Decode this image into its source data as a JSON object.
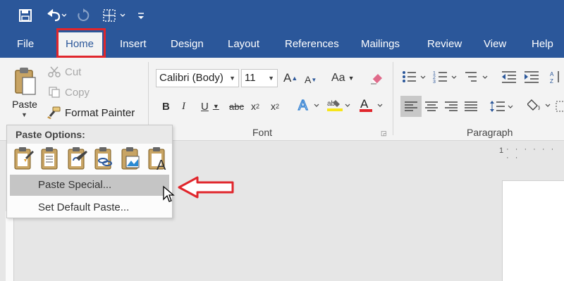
{
  "quick_access": {
    "items": [
      "save-icon",
      "undo-icon",
      "redo-icon",
      "table-icon",
      "customize-icon"
    ]
  },
  "tabs": [
    {
      "label": "File"
    },
    {
      "label": "Home"
    },
    {
      "label": "Insert"
    },
    {
      "label": "Design"
    },
    {
      "label": "Layout"
    },
    {
      "label": "References"
    },
    {
      "label": "Mailings"
    },
    {
      "label": "Review"
    },
    {
      "label": "View"
    },
    {
      "label": "Help"
    }
  ],
  "clipboard": {
    "paste_label": "Paste",
    "cut_label": "Cut",
    "copy_label": "Copy",
    "format_painter_label": "Format Painter"
  },
  "font": {
    "name": "Calibri (Body)",
    "size": "11",
    "group_label": "Font"
  },
  "paragraph": {
    "group_label": "Paragraph"
  },
  "paste_menu": {
    "header": "Paste Options:",
    "items": [
      "Paste Special...",
      "Set Default Paste..."
    ]
  },
  "ruler": {
    "mark": "1"
  },
  "colors": {
    "brand": "#2b579a",
    "highlight_red": "#e0262c"
  }
}
